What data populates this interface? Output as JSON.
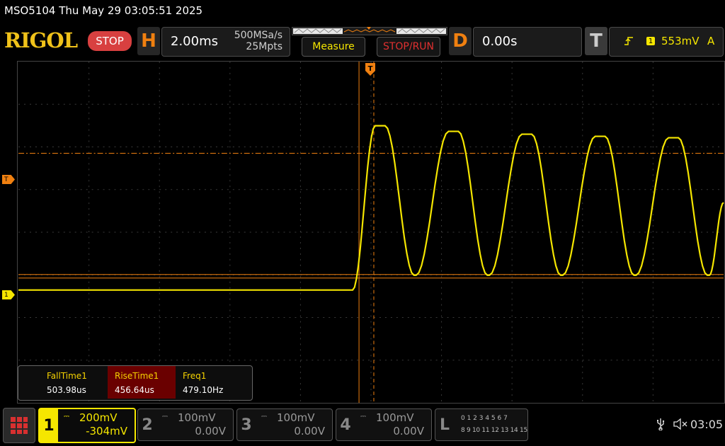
{
  "title": "MSO5104  Thu May 29 03:05:51 2025",
  "brand": "RIGOL",
  "run_state": "STOP",
  "horizontal": {
    "letter": "H",
    "timebase": "2.00ms",
    "sample_rate": "500MSa/s",
    "memory_depth": "25Mpts"
  },
  "buttons": {
    "measure": "Measure",
    "stop_run": "STOP/RUN"
  },
  "delay": {
    "letter": "D",
    "value": "0.00s"
  },
  "trigger": {
    "letter": "T",
    "source": "1",
    "level": "553mV",
    "mode": "A",
    "marker": "T"
  },
  "channel1_marker": "1",
  "measurements": [
    {
      "name": "FallTime1",
      "value": "503.98us"
    },
    {
      "name": "RiseTime1",
      "value": "456.64us"
    },
    {
      "name": "Freq1",
      "value": "479.10Hz"
    }
  ],
  "channels": [
    {
      "num": "1",
      "scale": "200mV",
      "offset": "-304mV",
      "active": true,
      "color": "#f5e600"
    },
    {
      "num": "2",
      "scale": "100mV",
      "offset": "0.00V",
      "active": false,
      "color": "#888888"
    },
    {
      "num": "3",
      "scale": "100mV",
      "offset": "0.00V",
      "active": false,
      "color": "#888888"
    },
    {
      "num": "4",
      "scale": "100mV",
      "offset": "0.00V",
      "active": false,
      "color": "#888888"
    }
  ],
  "logic": {
    "letter": "L",
    "row1": "0 1 2 3  4 5 6 7",
    "row2": "8 9 10 11 12 13 14 15"
  },
  "clock": "03:05",
  "colors": {
    "trace": "#f5e600",
    "accent": "#f08010",
    "stop": "#d84040"
  }
}
